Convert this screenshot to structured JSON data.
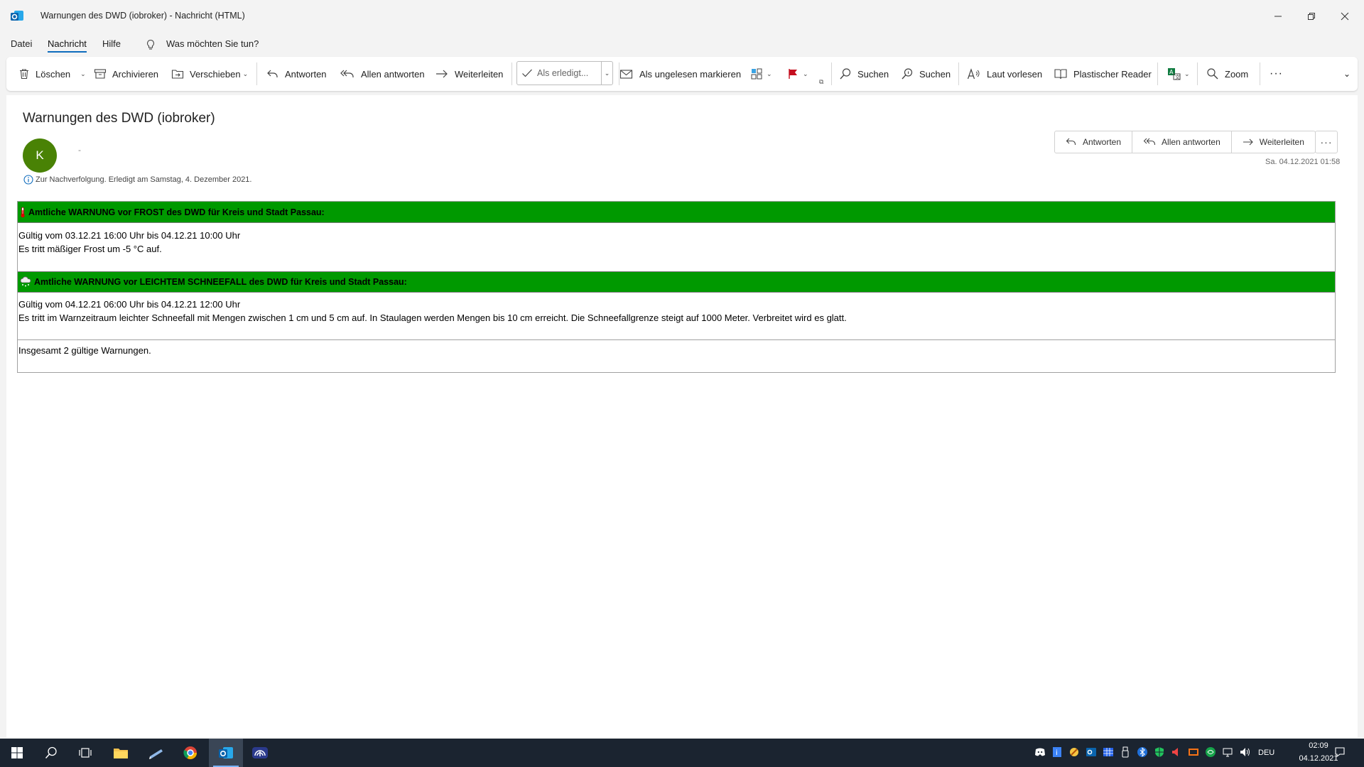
{
  "window": {
    "title": "Warnungen des DWD (iobroker)  -  Nachricht (HTML)"
  },
  "menu": {
    "items": [
      "Datei",
      "Nachricht",
      "Hilfe"
    ],
    "active": "Nachricht",
    "tell_me": "Was möchten Sie tun?"
  },
  "ribbon": {
    "delete": "Löschen",
    "archive": "Archivieren",
    "move": "Verschieben",
    "reply": "Antworten",
    "reply_all": "Allen antworten",
    "forward": "Weiterleiten",
    "mark_done": "Als erledigt...",
    "mark_unread": "Als ungelesen markieren",
    "search1": "Suchen",
    "search2": "Suchen",
    "read_aloud": "Laut vorlesen",
    "immersive_reader": "Plastischer Reader",
    "zoom": "Zoom"
  },
  "message": {
    "subject": "Warnungen des DWD (iobroker)",
    "avatar_initial": "K",
    "sender": "-",
    "followup": "Zur Nachverfolgung.  Erledigt am Samstag, 4. Dezember 2021.",
    "actions": {
      "reply": "Antworten",
      "reply_all": "Allen antworten",
      "forward": "Weiterleiten"
    },
    "date": "Sa. 04.12.2021 01:58"
  },
  "warnings": [
    {
      "icon": "thermometer-icon",
      "title": "Amtliche WARNUNG vor FROST des DWD für Kreis und Stadt Passau:",
      "validity": "Gültig vom 03.12.21 16:00 Uhr bis 04.12.21 10:00 Uhr",
      "text": "Es tritt mäßiger Frost um -5 °C auf."
    },
    {
      "icon": "snow-cloud-icon",
      "title": "Amtliche WARNUNG vor LEICHTEM SCHNEEFALL des DWD für Kreis und Stadt Passau:",
      "validity": "Gültig vom 04.12.21 06:00 Uhr bis 04.12.21 12:00 Uhr",
      "text": "Es tritt im Warnzeitraum leichter Schneefall mit Mengen zwischen 1 cm und 5 cm auf. In Staulagen werden Mengen bis 10 cm erreicht. Die Schneefallgrenze steigt auf 1000 Meter. Verbreitet wird es glatt."
    }
  ],
  "summary": "Insgesamt 2 gültige Warnungen.",
  "colors": {
    "warning_header": "#009900",
    "avatar": "#498205",
    "taskbar": "#1b2430",
    "accent": "#0f6cbd"
  },
  "taskbar": {
    "language": "DEU",
    "time": "02:09",
    "date": "04.12.2021"
  }
}
